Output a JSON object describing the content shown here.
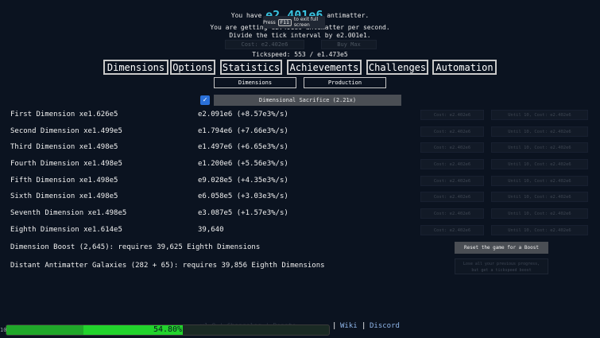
{
  "header": {
    "am_prefix": "You have",
    "am_amount": "e2.401e6",
    "am_suffix": "antimatter.",
    "rate_text": "You are getting e2.401e6 antimatter per second.",
    "interval_text": "Divide the tick interval by e2.001e1.",
    "tickspeed_text": "Tickspeed: 553 / e1.473e5",
    "faint_cost": "Cost: e2.402e6",
    "faint_buymax": "Buy Max"
  },
  "fullscreen": {
    "press": "Press",
    "key": "F11",
    "rest": "to exit full screen"
  },
  "tabs": [
    "Dimensions",
    "Options",
    "Statistics",
    "Achievements",
    "Challenges",
    "Automation"
  ],
  "subtabs": [
    "Dimensions",
    "Production"
  ],
  "sacrifice": {
    "checked": true,
    "label": "Dimensional Sacrifice (2.21x)"
  },
  "dimensions": [
    {
      "name": "First Dimension xe1.626e5",
      "amount": "e2.091e6 (+8.57e3%/s)",
      "cost": "Cost: e2.402e6",
      "until": "Until 10, Cost: e2.402e6"
    },
    {
      "name": "Second Dimension xe1.499e5",
      "amount": "e1.794e6 (+7.66e3%/s)",
      "cost": "Cost: e2.402e6",
      "until": "Until 10, Cost: e2.402e6"
    },
    {
      "name": "Third Dimension xe1.498e5",
      "amount": "e1.497e6 (+6.65e3%/s)",
      "cost": "Cost: e2.402e6",
      "until": "Until 10, Cost: e2.402e6"
    },
    {
      "name": "Fourth Dimension xe1.498e5",
      "amount": "e1.200e6 (+5.56e3%/s)",
      "cost": "Cost: e2.402e6",
      "until": "Until 10, Cost: e2.402e6"
    },
    {
      "name": "Fifth Dimension xe1.498e5",
      "amount": "e9.028e5 (+4.35e3%/s)",
      "cost": "Cost: e2.402e6",
      "until": "Until 10, Cost: e2.402e6"
    },
    {
      "name": "Sixth Dimension xe1.498e5",
      "amount": "e6.058e5 (+3.03e3%/s)",
      "cost": "Cost: e2.402e6",
      "until": "Until 10, Cost: e2.402e6"
    },
    {
      "name": "Seventh Dimension xe1.498e5",
      "amount": "e3.087e5 (+1.57e3%/s)",
      "cost": "Cost: e2.402e6",
      "until": "Until 10, Cost: e2.402e6"
    },
    {
      "name": "Eighth Dimension xe1.614e5",
      "amount": "39,640",
      "cost": "Cost: e2.402e6",
      "until": "Until 10, Cost: e2.402e6"
    }
  ],
  "boost": {
    "text": "Dimension Boost (2,645): requires 39,625 Eighth Dimensions",
    "button": "Reset the game for a Boost"
  },
  "galaxy": {
    "text": "Distant Antimatter Galaxies (282 + 65): requires 39,856 Eighth Dimensions",
    "button_line1": "Lose all your previous progress,",
    "button_line2": "but get a tickspeed boost"
  },
  "footer": {
    "faint_text": "v1.0 | Changelog | Donate",
    "separator": "|",
    "wiki": "Wiki",
    "discord": "Discord"
  },
  "progress": {
    "fraction": 0.548,
    "text": "54.80%",
    "left_label": "10"
  },
  "colors": {
    "accent": "#3ac4e0",
    "progress": "#22d32c",
    "background": "#0b1320"
  }
}
